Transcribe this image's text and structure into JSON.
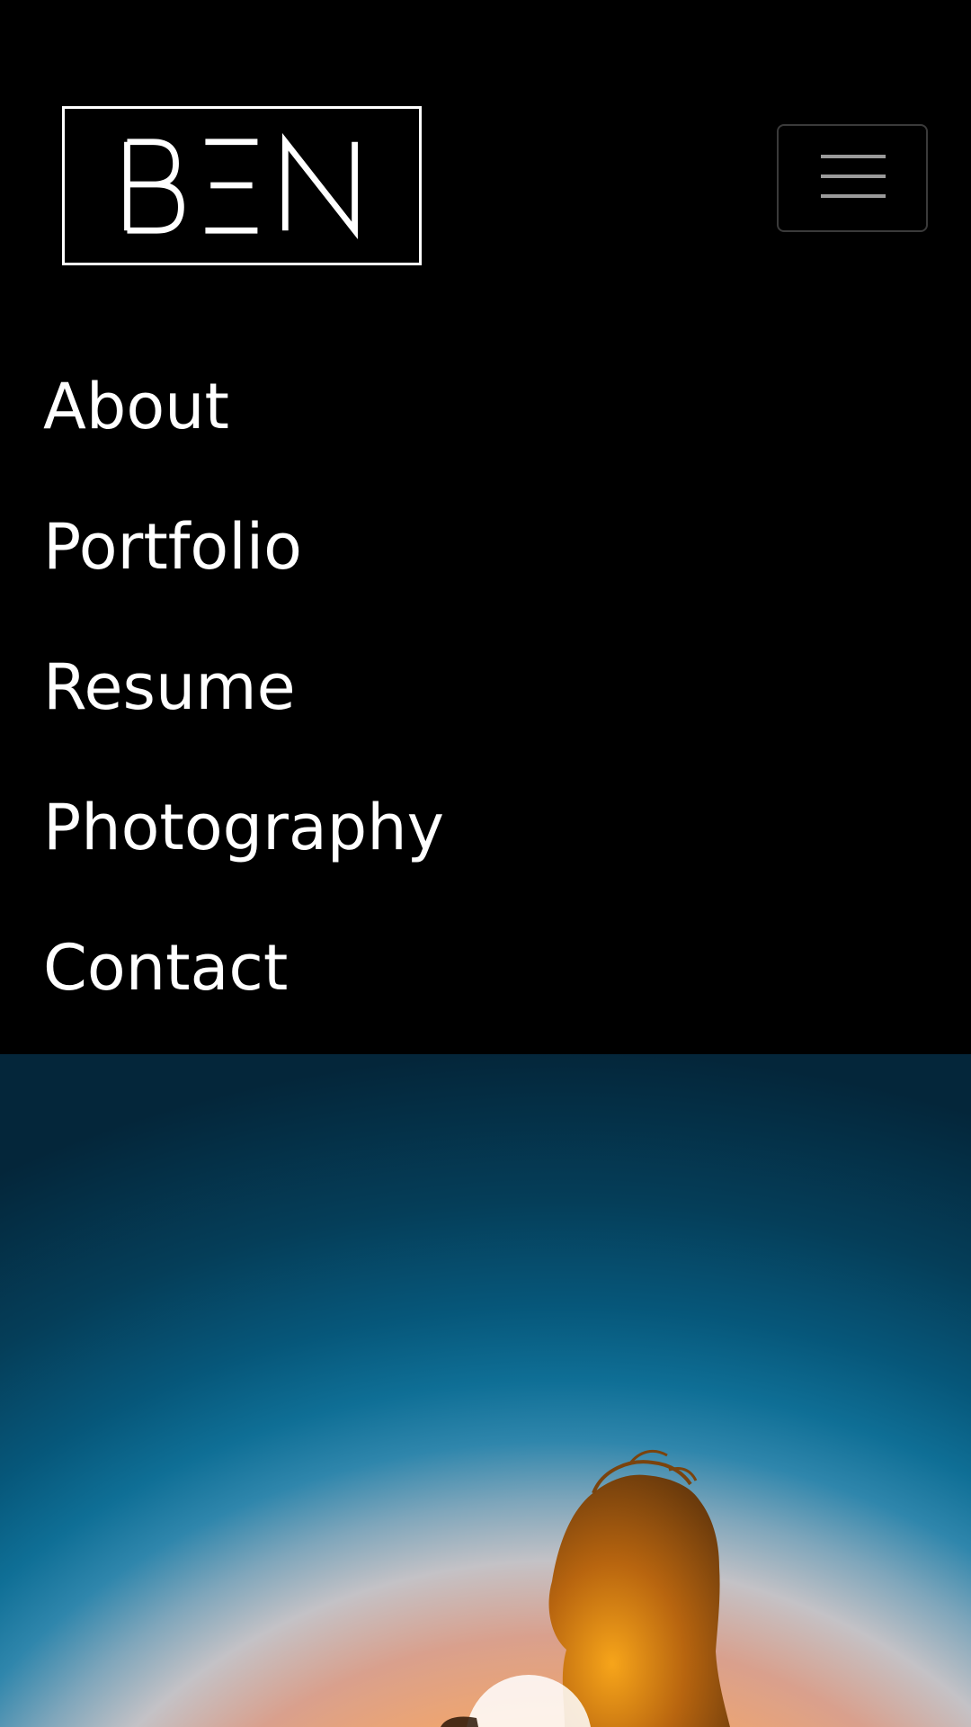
{
  "brand": {
    "logo_text": "BΞN"
  },
  "navbar": {
    "toggler_icon": "hamburger-icon",
    "items": [
      {
        "label": "About"
      },
      {
        "label": "Portfolio"
      },
      {
        "label": "Resume"
      },
      {
        "label": "Photography"
      },
      {
        "label": "Contact"
      }
    ]
  },
  "hero": {
    "image": "silhouette-at-sunset"
  },
  "colors": {
    "background": "#000000",
    "text": "#ffffff",
    "toggler_border": "#3a3a3a",
    "toggler_bars": "#9a9a9a"
  }
}
